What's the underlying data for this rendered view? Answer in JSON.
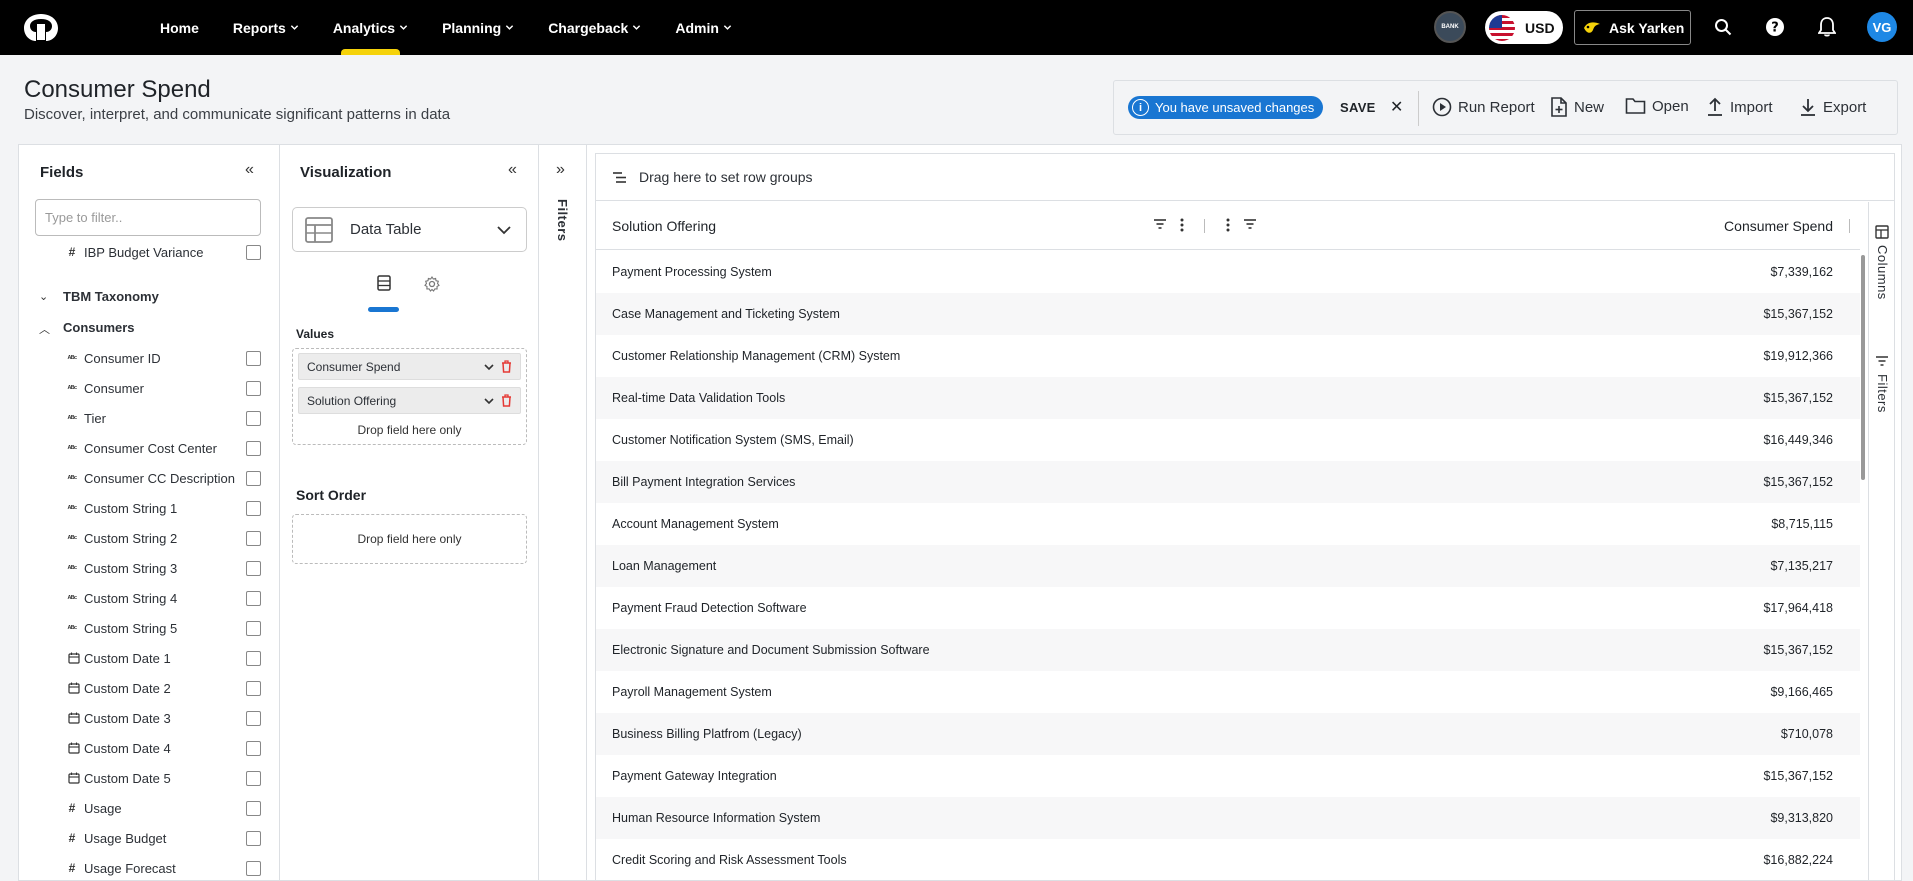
{
  "nav": {
    "items": [
      {
        "label": "Home",
        "dropdown": false
      },
      {
        "label": "Reports",
        "dropdown": true
      },
      {
        "label": "Analytics",
        "dropdown": true,
        "active": true
      },
      {
        "label": "Planning",
        "dropdown": true
      },
      {
        "label": "Chargeback",
        "dropdown": true
      },
      {
        "label": "Admin",
        "dropdown": true
      }
    ],
    "bank_label": "BANK",
    "currency": "USD",
    "ask_label": "Ask Yarken",
    "avatar_initials": "VG",
    "accent_color": "#f5d20a"
  },
  "header": {
    "title": "Consumer Spend",
    "subtitle": "Discover, interpret, and communicate significant patterns in data"
  },
  "toolbar": {
    "unsaved_label": "You have unsaved changes",
    "save_label": "SAVE",
    "close_label": "✕",
    "run_label": "Run Report",
    "new_label": "New",
    "open_label": "Open",
    "import_label": "Import",
    "export_label": "Export"
  },
  "fields": {
    "title": "Fields",
    "filter_placeholder": "Type to filter..",
    "top_item": {
      "label": "IBP Budget Variance",
      "type": "#"
    },
    "groups": [
      {
        "label": "TBM Taxonomy",
        "expanded": false
      },
      {
        "label": "Consumers",
        "expanded": true
      }
    ],
    "items": [
      {
        "label": "Consumer ID",
        "type": "abc"
      },
      {
        "label": "Consumer",
        "type": "abc"
      },
      {
        "label": "Tier",
        "type": "abc"
      },
      {
        "label": "Consumer Cost Center",
        "type": "abc"
      },
      {
        "label": "Consumer CC Description",
        "type": "abc"
      },
      {
        "label": "Custom String 1",
        "type": "abc"
      },
      {
        "label": "Custom String 2",
        "type": "abc"
      },
      {
        "label": "Custom String 3",
        "type": "abc"
      },
      {
        "label": "Custom String 4",
        "type": "abc"
      },
      {
        "label": "Custom String 5",
        "type": "abc"
      },
      {
        "label": "Custom Date 1",
        "type": "date"
      },
      {
        "label": "Custom Date 2",
        "type": "date"
      },
      {
        "label": "Custom Date 3",
        "type": "date"
      },
      {
        "label": "Custom Date 4",
        "type": "date"
      },
      {
        "label": "Custom Date 5",
        "type": "date"
      },
      {
        "label": "Usage",
        "type": "#"
      },
      {
        "label": "Usage Budget",
        "type": "#"
      },
      {
        "label": "Usage Forecast",
        "type": "#"
      }
    ]
  },
  "visualization": {
    "title": "Visualization",
    "selected": "Data Table",
    "values_label": "Values",
    "values": [
      "Consumer Spend",
      "Solution Offering"
    ],
    "drop_text": "Drop field here only",
    "sort_title": "Sort Order",
    "sort_drop_text": "Drop field here only"
  },
  "filters_strip_label": "Filters",
  "grid": {
    "row_group_text": "Drag here to set row groups",
    "col1": "Solution Offering",
    "col2": "Consumer Spend",
    "side_columns": "Columns",
    "side_filters": "Filters",
    "rows": [
      {
        "offering": "Payment Processing System",
        "spend": "$7,339,162"
      },
      {
        "offering": "Case Management and Ticketing System",
        "spend": "$15,367,152"
      },
      {
        "offering": "Customer Relationship Management (CRM) System",
        "spend": "$19,912,366"
      },
      {
        "offering": "Real-time Data Validation Tools",
        "spend": "$15,367,152"
      },
      {
        "offering": "Customer Notification System (SMS, Email)",
        "spend": "$16,449,346"
      },
      {
        "offering": "Bill Payment Integration Services",
        "spend": "$15,367,152"
      },
      {
        "offering": "Account Management System",
        "spend": "$8,715,115"
      },
      {
        "offering": "Loan Management",
        "spend": "$7,135,217"
      },
      {
        "offering": "Payment Fraud Detection Software",
        "spend": "$17,964,418"
      },
      {
        "offering": "Electronic Signature and Document Submission Software",
        "spend": "$15,367,152"
      },
      {
        "offering": "Payroll Management System",
        "spend": "$9,166,465"
      },
      {
        "offering": "Business Billing Platfrom (Legacy)",
        "spend": "$710,078"
      },
      {
        "offering": "Payment Gateway Integration",
        "spend": "$15,367,152"
      },
      {
        "offering": "Human Resource Information System",
        "spend": "$9,313,820"
      },
      {
        "offering": "Credit Scoring and Risk Assessment Tools",
        "spend": "$16,882,224"
      }
    ]
  }
}
